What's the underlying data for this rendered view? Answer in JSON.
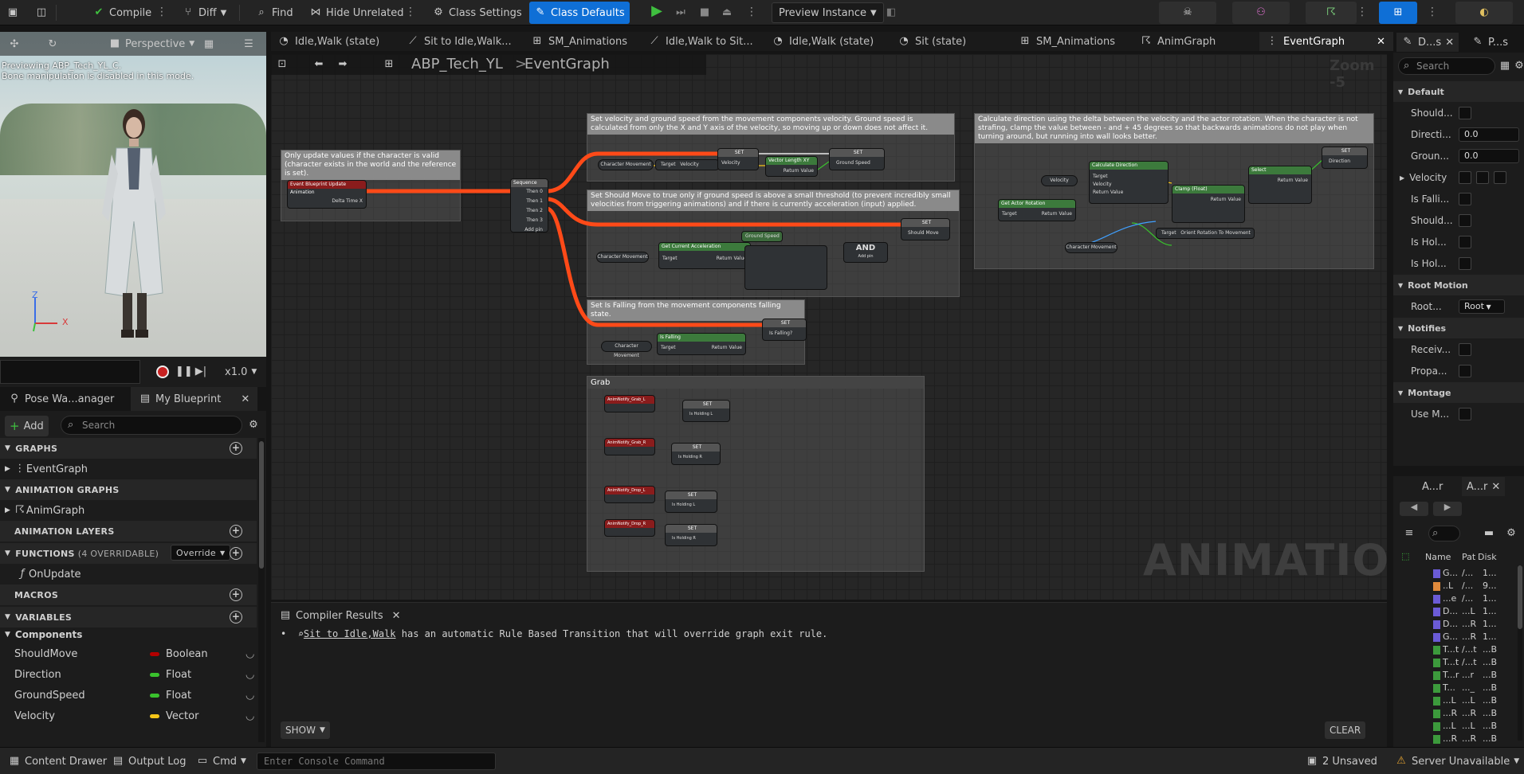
{
  "toolbar": {
    "compile": "Compile",
    "diff": "Diff",
    "find": "Find",
    "hide_unrelated": "Hide Unrelated",
    "class_settings": "Class Settings",
    "class_defaults": "Class Defaults",
    "preview_instance": "Preview Instance"
  },
  "tabs": [
    "Idle,Walk (state)",
    "Sit  to Idle,Walk...",
    "SM_Animations",
    "Idle,Walk to Sit...",
    "Idle,Walk (state)",
    "Sit  (state)",
    "SM_Animations",
    "AnimGraph",
    "EventGraph"
  ],
  "graph": {
    "breadcrumb_root": "ABP_Tech_YL",
    "breadcrumb_sep": ">",
    "breadcrumb_leaf": "EventGraph",
    "zoom": "Zoom -5",
    "watermark": "ANIMATION",
    "comments": {
      "c1": "Only update values if the character is valid (character exists in the world and the reference is set).",
      "c2": "Set velocity and ground speed from the movement components velocity. Ground speed is calculated from only the X and Y axis of the velocity, so moving up or down does not affect it.",
      "c3": "Set Should Move to true only if ground speed is above a small threshold (to prevent incredibly small velocities from triggering animations) and if there is currently acceleration (input) applied.",
      "c4": "Set Is Falling from the movement components falling state.",
      "c5": "Grab",
      "c6": "Calculate direction using the delta between the velocity and the actor rotation. When the character is not strafing, clamp the value between - and + 45 degrees so that backwards animations do not play when turning around, but running into wall looks better."
    },
    "nodes": {
      "update": "Event Blueprint Update Animation",
      "delta": "Delta Time X",
      "sequence": "Sequence",
      "then0": "Then 0",
      "then1": "Then 1",
      "then2": "Then 2",
      "then3": "Then 3",
      "addpin": "Add pin",
      "charmove": "Character Movement",
      "set": "SET",
      "velocity": "Velocity",
      "groundspeed": "Ground Speed",
      "vlen": "Vector Length XY",
      "getaccel": "Get Current Acceleration",
      "shouldmove": "Should Move",
      "and": "AND",
      "isfalling": "Is Falling",
      "isfallingq": "Is Falling?",
      "target": "Target",
      "retval": "Return Value",
      "calcdir": "Calculate Direction",
      "getrot": "Get Actor Rotation",
      "clamp": "Clamp (Float)",
      "select": "Select",
      "direction": "Direction",
      "orient": "Orient Rotation To Movement",
      "grab_l": "AnimNotify_Grab_L",
      "grab_r": "AnimNotify_Grab_R",
      "drop_l": "AnimNotify_Drop_L",
      "drop_r": "AnimNotify_Drop_R",
      "holding_l": "Is Holding L",
      "holding_r": "Is Holding R"
    }
  },
  "viewport": {
    "perspective": "Perspective",
    "preview_line1": "Previewing ABP_Tech_YL_C.",
    "preview_line2": "Bone manipulation is disabled in this mode.",
    "speed": "x1.0",
    "axis_z": "Z",
    "axis_x": "X"
  },
  "left": {
    "tab1": "Pose Wa...anager",
    "tab2": "My Blueprint",
    "add": "Add",
    "search_placeholder": "Search",
    "graphs": "GRAPHS",
    "eventgraph": "EventGraph",
    "anim_graphs": "ANIMATION GRAPHS",
    "animgraph": "AnimGraph",
    "anim_layers": "ANIMATION LAYERS",
    "functions": "FUNCTIONS",
    "functions_count": "(4 OVERRIDABLE)",
    "override": "Override",
    "onupdate": "OnUpdate",
    "macros": "MACROS",
    "variables": "VARIABLES",
    "components": "Components",
    "vars": [
      {
        "name": "ShouldMove",
        "type": "Boolean",
        "color": "#b30000"
      },
      {
        "name": "Direction",
        "type": "Float",
        "color": "#39c12d"
      },
      {
        "name": "GroundSpeed",
        "type": "Float",
        "color": "#39c12d"
      },
      {
        "name": "Velocity",
        "type": "Vector",
        "color": "#f5c518"
      }
    ]
  },
  "details": {
    "tab1": "D...s",
    "tab2": "P...s",
    "search_placeholder": "Search",
    "default": "Default",
    "should1": "Should...",
    "direction": "Directi...",
    "direction_val": "0.0",
    "ground": "Groun...",
    "ground_val": "0.0",
    "velocity": "Velocity",
    "isfalling": "Is Falli...",
    "should2": "Should...",
    "ishol1": "Is Hol...",
    "ishol2": "Is Hol...",
    "root_motion": "Root Motion",
    "root": "Root...",
    "root_val": "Root",
    "notifies": "Notifies",
    "receiv": "Receiv...",
    "propa": "Propa...",
    "montage": "Montage",
    "usem": "Use M..."
  },
  "assets": {
    "tab1": "A...r",
    "tab2": "A...r",
    "col_name": "Name",
    "col_path": "Pat",
    "col_disk": "Disk",
    "rows": [
      {
        "n": "G...",
        "p": "/...",
        "d": "1...",
        "c": "#6b5bd6"
      },
      {
        "n": "..L",
        "p": "/...",
        "d": "9...",
        "c": "#e08a3c"
      },
      {
        "n": "...e",
        "p": "/...",
        "d": "1...",
        "c": "#6b5bd6"
      },
      {
        "n": "D...",
        "p": "...L",
        "d": "1...",
        "c": "#6b5bd6"
      },
      {
        "n": "D...",
        "p": "...R",
        "d": "1...",
        "c": "#6b5bd6"
      },
      {
        "n": "G...",
        "p": "...R",
        "d": "1...",
        "c": "#6b5bd6"
      },
      {
        "n": "T...t",
        "p": "/...t",
        "d": "...B",
        "c": "#3c9a3c"
      },
      {
        "n": "T...t",
        "p": "/...t",
        "d": "...B",
        "c": "#3c9a3c"
      },
      {
        "n": "T...r",
        "p": "...r",
        "d": "...B",
        "c": "#3c9a3c"
      },
      {
        "n": "T...",
        "p": "..._",
        "d": "...B",
        "c": "#3c9a3c"
      },
      {
        "n": "...L",
        "p": "...L",
        "d": "...B",
        "c": "#3c9a3c"
      },
      {
        "n": "...R",
        "p": "...R",
        "d": "...B",
        "c": "#3c9a3c"
      },
      {
        "n": "...L",
        "p": "...L",
        "d": "...B",
        "c": "#3c9a3c"
      },
      {
        "n": "...R",
        "p": "...R",
        "d": "...B",
        "c": "#3c9a3c"
      }
    ]
  },
  "compiler": {
    "title": "Compiler Results",
    "msg_link": "Sit  to Idle,Walk",
    "msg_rest": " has an automatic Rule Based Transition that will override graph exit rule.",
    "show": "SHOW",
    "clear": "CLEAR"
  },
  "status": {
    "content_drawer": "Content Drawer",
    "output_log": "Output Log",
    "cmd": "Cmd",
    "console_placeholder": "Enter Console Command",
    "unsaved": "2 Unsaved",
    "server": "Server Unavailable"
  },
  "colors": {
    "accent": "#0f6fd6",
    "exec_wire": "#ff4a18",
    "bool": "#b30000",
    "float": "#39c12d",
    "vector": "#f5c518"
  }
}
